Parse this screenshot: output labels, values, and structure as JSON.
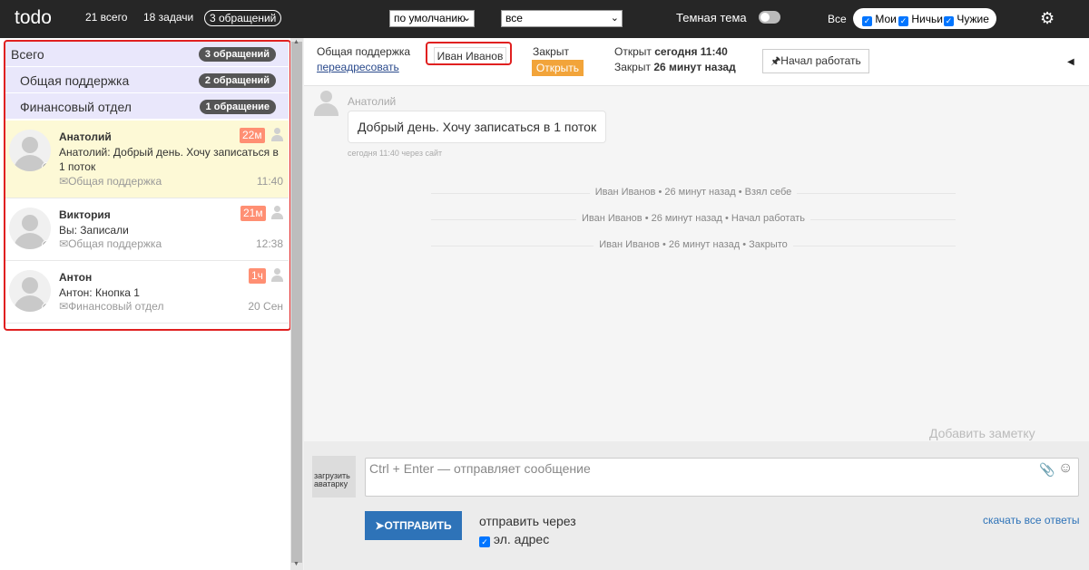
{
  "topbar": {
    "logo": "todo",
    "total": "21 всего",
    "tasks": "18 задачи",
    "tickets": "3 обращений",
    "sort_select": "по умолчанию",
    "filter_select": "все",
    "dark_theme_label": "Темная тема",
    "all_label": "Все",
    "filters": [
      {
        "label": "Мои",
        "checked": true
      },
      {
        "label": "Ничьи",
        "checked": true
      },
      {
        "label": "Чужие",
        "checked": true
      }
    ]
  },
  "sidebar": {
    "groups": [
      {
        "name": "Всего",
        "count": "3 обращений"
      },
      {
        "name": "Общая поддержка",
        "count": "2 обращений"
      },
      {
        "name": "Финансовый отдел",
        "count": "1 обращение"
      }
    ],
    "conversations": [
      {
        "name": "Анатолий",
        "message": "Анатолий: Добрый день. Хочу записаться в 1 поток",
        "department": "Общая поддержка",
        "time": "11:40",
        "badge": "22м",
        "active": true
      },
      {
        "name": "Виктория",
        "message": "Вы: Записали",
        "department": "Общая поддержка",
        "time": "12:38",
        "badge": "21м",
        "active": false
      },
      {
        "name": "Антон",
        "message": "Антон: Кнопка 1",
        "department": "Финансовый отдел",
        "time": "20 Сен",
        "badge": "1ч",
        "active": false
      }
    ]
  },
  "ticket": {
    "department": "Общая поддержка",
    "redirect_link": "переадресовать",
    "assignee": "Иван Иванов",
    "status": "Закрыт",
    "open_button": "Открыть",
    "opened_label": "Открыт",
    "opened_value": "сегодня 11:40",
    "closed_label": "Закрыт",
    "closed_value": "26 минут назад",
    "start_button": "Начал работать"
  },
  "chat": {
    "author": "Анатолий",
    "message": "Добрый день. Хочу записаться в 1 поток",
    "sent_info": "сегодня 11:40 через сайт",
    "events": [
      "Иван Иванов • 26 минут назад • Взял себе",
      "Иван Иванов • 26 минут назад • Начал работать",
      "Иван Иванов • 26 минут назад • Закрыто"
    ],
    "add_note": "Добавить заметку"
  },
  "composer": {
    "upload_avatar": "загрузить аватарку",
    "placeholder": "Ctrl + Enter — отправляет сообщение",
    "send_button": "ОТПРАВИТЬ",
    "send_via": "отправить через",
    "email_option": "эл. адрес",
    "download_all": "скачать все ответы"
  },
  "colors": {
    "topbar": "#262626",
    "accent_blue": "#2e73b8",
    "open_button": "#f2a43a",
    "time_badge": "#ff8f73",
    "group_bg": "#e9e7fb",
    "active_row": "#fdf9d6",
    "highlight_border": "#e02020"
  }
}
